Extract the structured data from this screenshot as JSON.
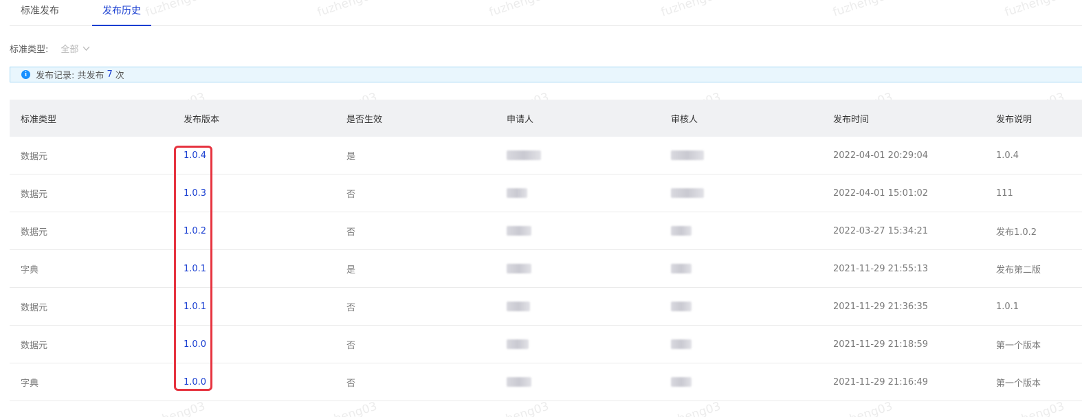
{
  "tabs": [
    {
      "label": "标准发布",
      "active": false
    },
    {
      "label": "发布历史",
      "active": true
    }
  ],
  "filter": {
    "label": "标准类型:",
    "value": "全部"
  },
  "alert": {
    "prefix": "发布记录: 共发布",
    "count": "7",
    "suffix": "次"
  },
  "table": {
    "headers": [
      "标准类型",
      "发布版本",
      "是否生效",
      "申请人",
      "审核人",
      "发布时间",
      "发布说明"
    ],
    "rows": [
      {
        "type": "数据元",
        "version": "1.0.4",
        "effective": "是",
        "time": "2022-04-01 20:29:04",
        "note": "1.0.4"
      },
      {
        "type": "数据元",
        "version": "1.0.3",
        "effective": "否",
        "time": "2022-04-01 15:01:02",
        "note": "111"
      },
      {
        "type": "数据元",
        "version": "1.0.2",
        "effective": "否",
        "time": "2022-03-27 15:34:21",
        "note": "发布1.0.2"
      },
      {
        "type": "字典",
        "version": "1.0.1",
        "effective": "是",
        "time": "2021-11-29 21:55:13",
        "note": "发布第二版"
      },
      {
        "type": "数据元",
        "version": "1.0.1",
        "effective": "否",
        "time": "2021-11-29 21:36:35",
        "note": "1.0.1"
      },
      {
        "type": "数据元",
        "version": "1.0.0",
        "effective": "否",
        "time": "2021-11-29 21:18:59",
        "note": "第一个版本"
      },
      {
        "type": "字典",
        "version": "1.0.0",
        "effective": "否",
        "time": "2021-11-29 21:16:49",
        "note": "第一个版本"
      }
    ]
  },
  "watermark": "fuzheng03",
  "colors": {
    "accent": "#1a3fd1",
    "highlight": "#e6333f",
    "alert_bg": "#e9f6fd",
    "alert_border": "#a3d8f5",
    "header_bg": "#f0f1f3"
  }
}
